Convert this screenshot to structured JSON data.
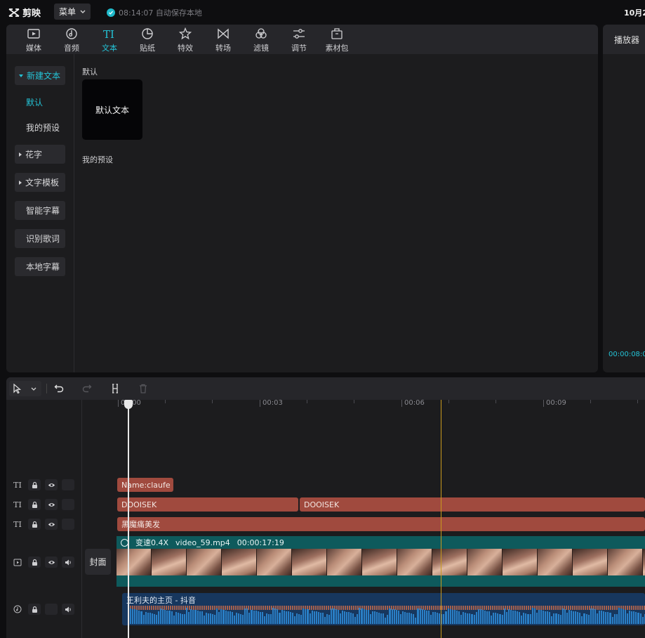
{
  "app": {
    "name": "剪映"
  },
  "topbar": {
    "menu_label": "菜单",
    "autosave_text": "08:14:07 自动保存本地",
    "date": "10月2"
  },
  "tabs": [
    {
      "label": "媒体",
      "icon": "media-icon"
    },
    {
      "label": "音频",
      "icon": "audio-icon"
    },
    {
      "label": "文本",
      "icon": "text-icon",
      "active": true
    },
    {
      "label": "贴纸",
      "icon": "sticker-icon"
    },
    {
      "label": "特效",
      "icon": "effects-icon"
    },
    {
      "label": "转场",
      "icon": "transition-icon"
    },
    {
      "label": "滤镜",
      "icon": "filter-icon"
    },
    {
      "label": "调节",
      "icon": "adjust-icon"
    },
    {
      "label": "素材包",
      "icon": "package-icon"
    }
  ],
  "sidebar": {
    "items": [
      {
        "label": "新建文本",
        "expanded": true
      },
      {
        "label": "默认",
        "selected": true
      },
      {
        "label": "我的预设"
      },
      {
        "label": "花字"
      },
      {
        "label": "文字模板"
      },
      {
        "label": "智能字幕"
      },
      {
        "label": "识别歌词"
      },
      {
        "label": "本地字幕"
      }
    ]
  },
  "content": {
    "section_default": "默认",
    "card_label": "默认文本",
    "section_presets": "我的预设"
  },
  "player": {
    "title": "播放器",
    "timecode": "00:00:08:0"
  },
  "timeline": {
    "ruler_labels": [
      "00:00",
      "00:03",
      "00:06",
      "00:09"
    ],
    "cover_label": "封面",
    "text_tracks": [
      {
        "clips": [
          "Name:claufe"
        ]
      },
      {
        "clips": [
          "DOOISEK",
          "DOOISEK"
        ]
      },
      {
        "clips": [
          "黑魔痛美发"
        ]
      }
    ],
    "video": {
      "speed": "变速0.4X",
      "filename": "video_59.mp4",
      "duration": "00:00:17:19"
    },
    "audio": {
      "title": "王利夫的主页 - 抖音"
    }
  }
}
